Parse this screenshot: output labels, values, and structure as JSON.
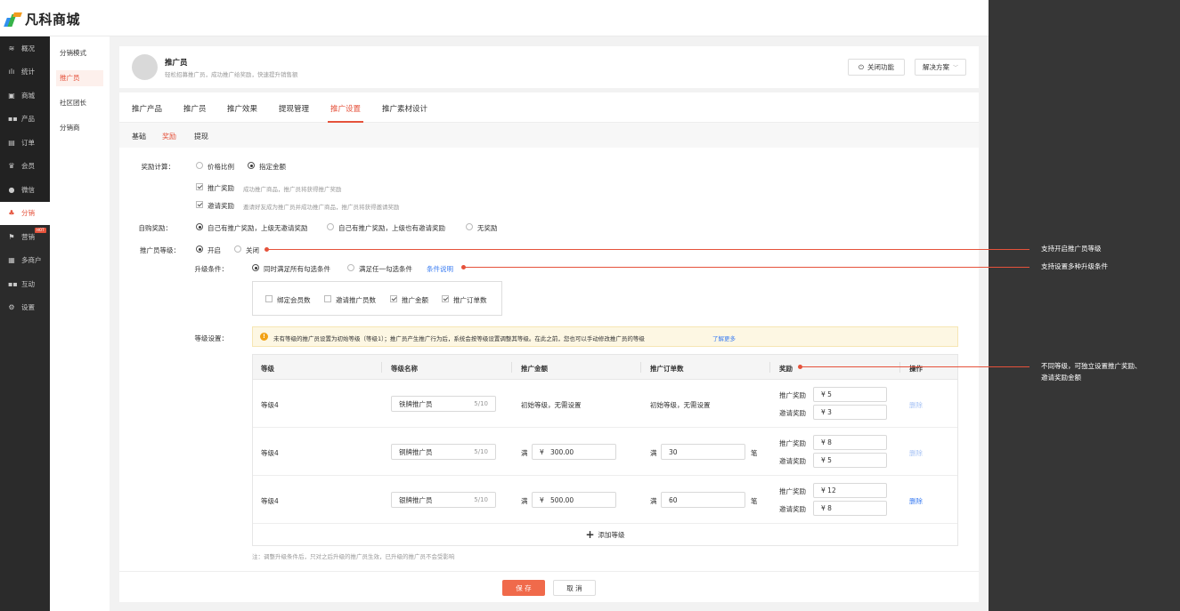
{
  "app": {
    "logo_text": "凡科商城"
  },
  "sidebar": {
    "items": [
      {
        "label": "概况",
        "icon": "layers-icon"
      },
      {
        "label": "统计",
        "icon": "chart-icon"
      },
      {
        "label": "商城",
        "icon": "store-icon"
      },
      {
        "label": "产品",
        "icon": "grid-icon"
      },
      {
        "label": "订单",
        "icon": "order-icon"
      },
      {
        "label": "会员",
        "icon": "crown-icon"
      },
      {
        "label": "微信",
        "icon": "wechat-icon"
      },
      {
        "label": "分销",
        "icon": "users-icon",
        "active": true
      },
      {
        "label": "营销",
        "icon": "flag-icon",
        "badge": "HOT"
      },
      {
        "label": "多商户",
        "icon": "shop-icon"
      },
      {
        "label": "互动",
        "icon": "apps-icon"
      },
      {
        "label": "设置",
        "icon": "gear-icon"
      }
    ]
  },
  "subnav": {
    "items": [
      {
        "label": "分销模式"
      },
      {
        "label": "推广员",
        "active": true
      },
      {
        "label": "社区团长"
      },
      {
        "label": "分销商"
      }
    ]
  },
  "promo": {
    "title": "推广员",
    "subtitle": "轻松招募推广员，成功推广给奖励，快速提升销售额",
    "close_btn": "关闭功能",
    "solution_btn": "解决方案"
  },
  "tabs": [
    "推广产品",
    "推广员",
    "推广效果",
    "提现管理",
    "推广设置",
    "推广素材设计"
  ],
  "subtabs": [
    "基础",
    "奖励",
    "提现"
  ],
  "form": {
    "reward_calc_label": "奖励计算：",
    "reward_calc_options": [
      "价格比例",
      "指定金额"
    ],
    "promo_reward_label": "推广奖励",
    "promo_reward_hint": "成功推广商品，推广员将获得推广奖励",
    "invite_reward_label": "邀请奖励",
    "invite_reward_hint": "邀请好友成为推广员并成功推广商品，推广员将获得邀请奖励",
    "self_buy_label": "自购奖励：",
    "self_buy_options": [
      "自己有推广奖励，上级无邀请奖励",
      "自己有推广奖励，上级也有邀请奖励",
      "无奖励"
    ],
    "level_label": "推广员等级：",
    "level_options": [
      "开启",
      "关闭"
    ],
    "upgrade_label": "升级条件：",
    "upgrade_options": [
      "同时满足所有勾选条件",
      "满足任一勾选条件"
    ],
    "upgrade_link": "条件说明",
    "conditions": [
      {
        "label": "绑定会员数",
        "checked": false
      },
      {
        "label": "邀请推广员数",
        "checked": false
      },
      {
        "label": "推广金额",
        "checked": true
      },
      {
        "label": "推广订单数",
        "checked": true
      }
    ],
    "grade_label": "等级设置：",
    "alert_text": "未有等级的推广员设置为初始等级（等级1）；推广员产生推广行为后，系统会按等级设置调整其等级。在此之前，您也可以手动修改推广员的等级",
    "alert_link": "了解更多"
  },
  "table": {
    "headers": [
      "等级",
      "等级名称",
      "推广金额",
      "推广订单数",
      "奖励",
      "操作"
    ],
    "rows": [
      {
        "level": "等级4",
        "name": "铁牌推广员",
        "count": "5/10",
        "amount": "初始等级，无需设置",
        "amount_prefix": "",
        "orders": "初始等级，无需设置",
        "orders_prefix": "",
        "orders_unit": "",
        "promo_reward": "5",
        "invite_reward": "3",
        "delete": "删除"
      },
      {
        "level": "等级4",
        "name": "铜牌推广员",
        "count": "5/10",
        "amount": "300.00",
        "amount_prefix": "满",
        "orders": "30",
        "orders_prefix": "满",
        "orders_unit": "笔",
        "promo_reward": "8",
        "invite_reward": "5",
        "delete": "删除"
      },
      {
        "level": "等级4",
        "name": "银牌推广员",
        "count": "5/10",
        "amount": "500.00",
        "amount_prefix": "满",
        "orders": "60",
        "orders_prefix": "满",
        "orders_unit": "笔",
        "promo_reward": "12",
        "invite_reward": "8",
        "delete": "删除"
      }
    ],
    "promo_reward_label": "推广奖励",
    "invite_reward_label": "邀请奖励",
    "currency": "¥",
    "add_label": "添加等级"
  },
  "note": "注：调整升级条件后，只对之后升级的推广员生效，已升级的推广员不会受影响",
  "footer": {
    "save": "保 存",
    "cancel": "取 消"
  },
  "annotations": [
    "支持开启推广员等级",
    "支持设置多种升级条件",
    "不同等级，可独立设置推广奖励、",
    "邀请奖励金额"
  ],
  "colors": {
    "accent": "#e5523b",
    "link": "#3a7cf2",
    "sidebar_bg": "#2b2b2b",
    "primary_btn": "#f06a4b"
  }
}
